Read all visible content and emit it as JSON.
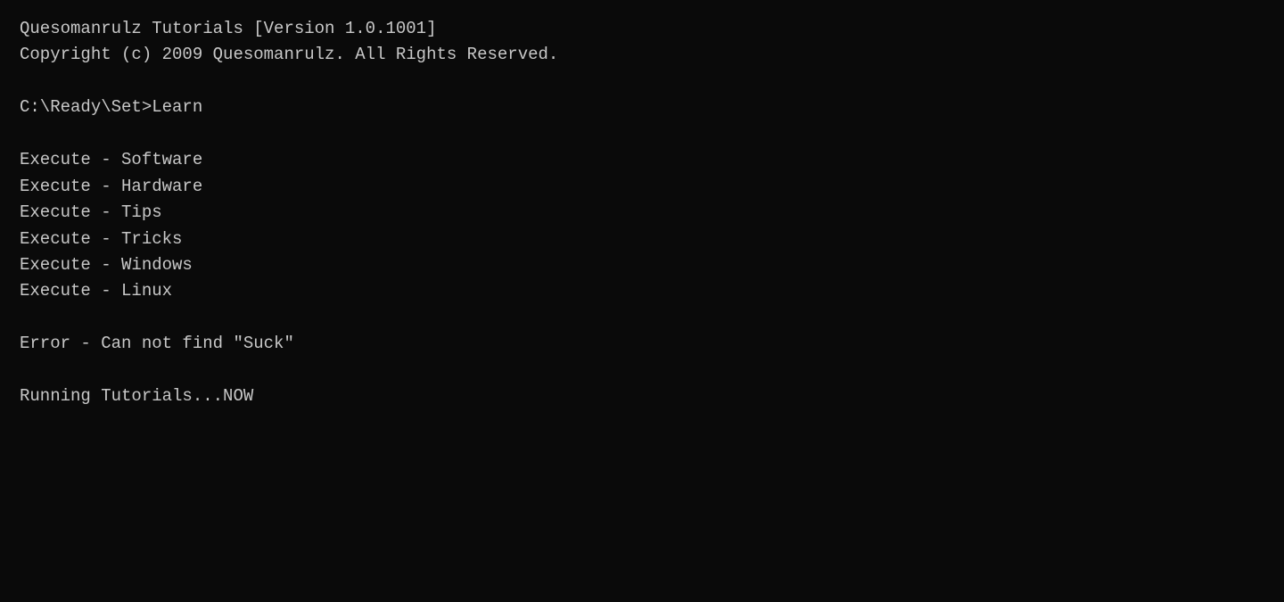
{
  "terminal": {
    "title_line1": "Quesomanrulz Tutorials [Version 1.0.1001]",
    "title_line2": "Copyright (c) 2009 Quesomanrulz. All Rights Reserved.",
    "prompt": "C:\\Ready\\Set>Learn",
    "execute_items": [
      "Execute - Software",
      "Execute - Hardware",
      "Execute - Tips",
      "Execute - Tricks",
      "Execute - Windows",
      "Execute - Linux"
    ],
    "error_line": "Error - Can not find \"Suck\"",
    "running_line": "Running Tutorials...NOW"
  }
}
